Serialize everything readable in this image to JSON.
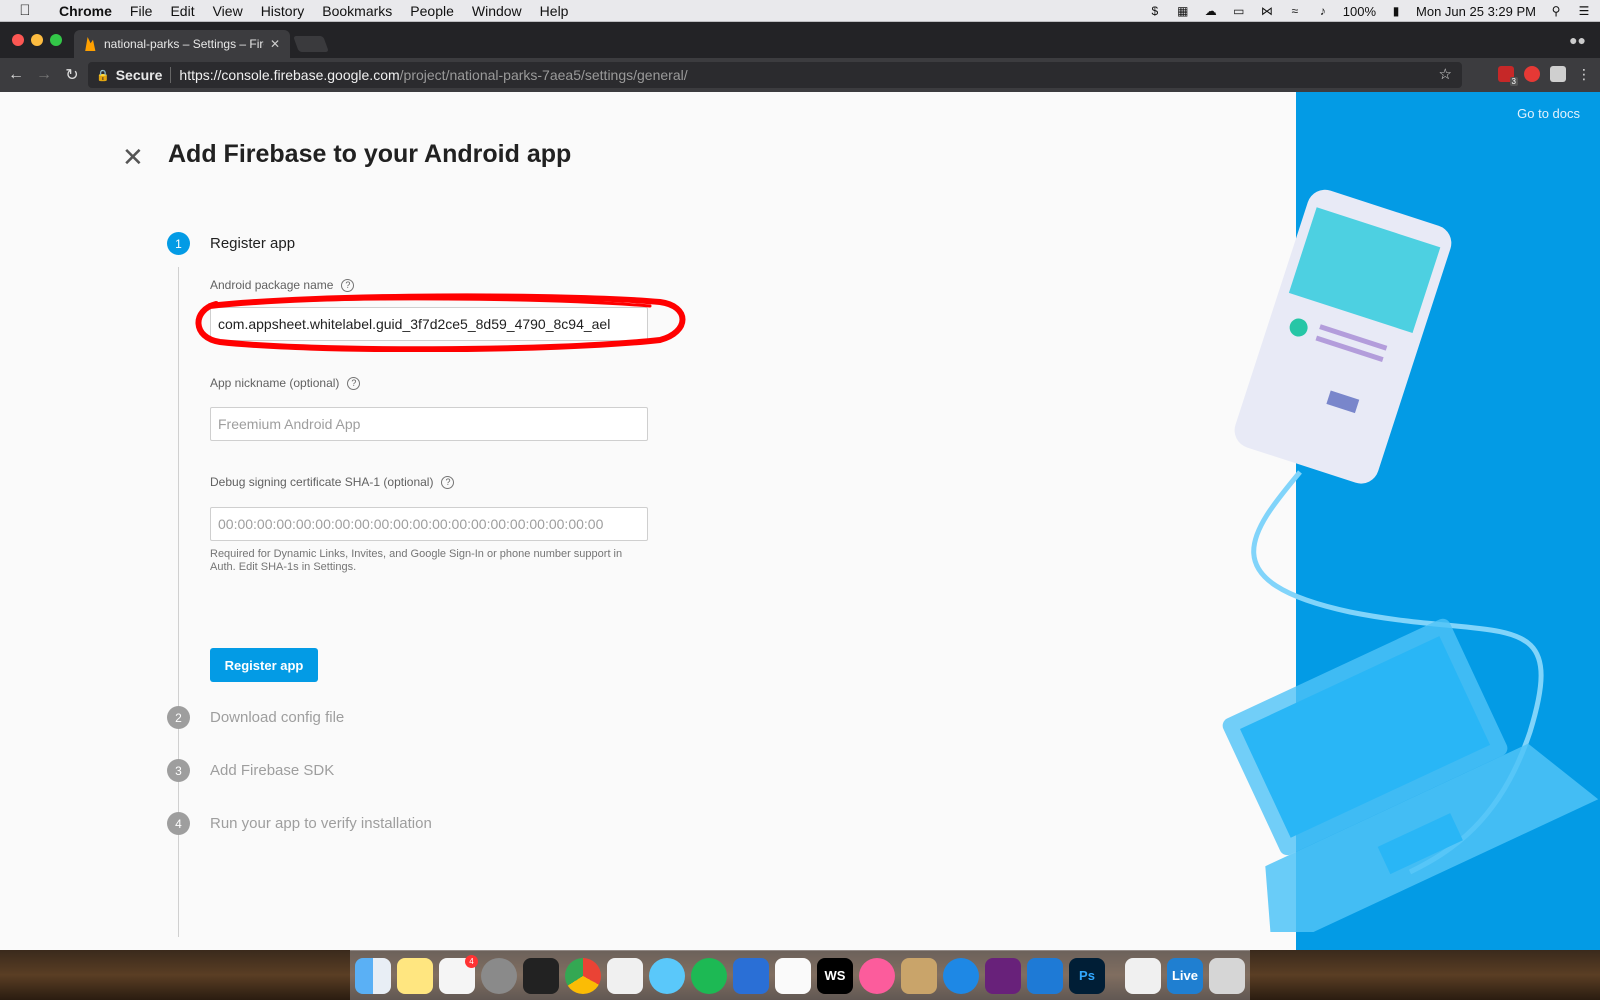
{
  "menubar": {
    "app_name": "Chrome",
    "items": [
      "File",
      "Edit",
      "View",
      "History",
      "Bookmarks",
      "People",
      "Window",
      "Help"
    ],
    "battery": "100%",
    "datetime": "Mon Jun 25  3:29 PM"
  },
  "browser": {
    "tab_title": "national-parks – Settings – Fire",
    "secure_label": "Secure",
    "url_host": "https://console.firebase.google.com",
    "url_path": "/project/national-parks-7aea5/settings/general/",
    "extension_badge": "3"
  },
  "page": {
    "title": "Add Firebase to your Android app",
    "go_to_docs": "Go to docs",
    "steps": [
      {
        "num": "1",
        "label": "Register app"
      },
      {
        "num": "2",
        "label": "Download config file"
      },
      {
        "num": "3",
        "label": "Add Firebase SDK"
      },
      {
        "num": "4",
        "label": "Run your app to verify installation"
      }
    ],
    "package_label": "Android package name",
    "package_value": "com.appsheet.whitelabel.guid_3f7d2ce5_8d59_4790_8c94_ael",
    "nickname_label": "App nickname (optional)",
    "nickname_placeholder": "Freemium Android App",
    "sha_label": "Debug signing certificate SHA-1 (optional)",
    "sha_placeholder": "00:00:00:00:00:00:00:00:00:00:00:00:00:00:00:00:00:00:00:00",
    "sha_helper": "Required for Dynamic Links, Invites, and Google Sign-In or phone number support in Auth. Edit SHA-1s in Settings.",
    "register_button": "Register app",
    "help_glyph": "?"
  },
  "dock": {
    "reminders_badge": "4",
    "apps": [
      "Finder",
      "Notes",
      "Reminders",
      "System Preferences",
      "Terminal",
      "Chrome",
      "Slack",
      "Messages",
      "Spotify",
      "CloudApp",
      "TextEdit",
      "WebStorm",
      "iTunes",
      "Keychain",
      "Safari",
      "Visual Studio",
      "Xcode",
      "Photoshop",
      "iTunes Producer",
      "Live",
      "Trash"
    ],
    "webstorm_label": "WS",
    "photoshop_label": "Ps",
    "live_label": "Live"
  },
  "colors": {
    "accent": "#039be5",
    "annotation": "#ff0000"
  }
}
